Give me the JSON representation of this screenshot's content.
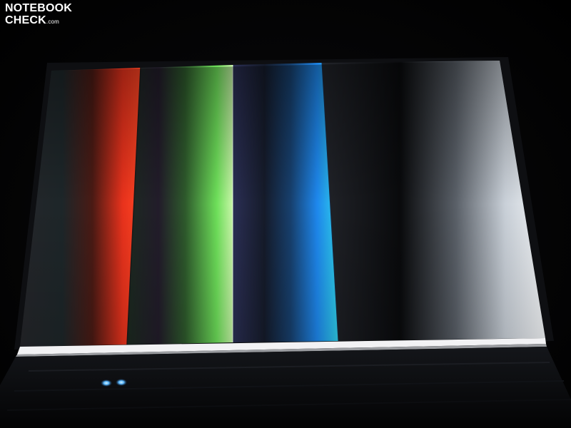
{
  "photo": {
    "subject": "laptop-display-gradient-test-pattern",
    "colors": {
      "background": "#000000",
      "red": "#ff3a1e",
      "green": "#9cf070",
      "blue": "#1e8cff",
      "white": "#ffffff",
      "bezel_light": "#f2f2f4",
      "status_led": "#5ab8ff"
    }
  },
  "watermark": {
    "line1": "NOTEBOOK",
    "line2": "CHECK",
    "suffix": ".com"
  }
}
